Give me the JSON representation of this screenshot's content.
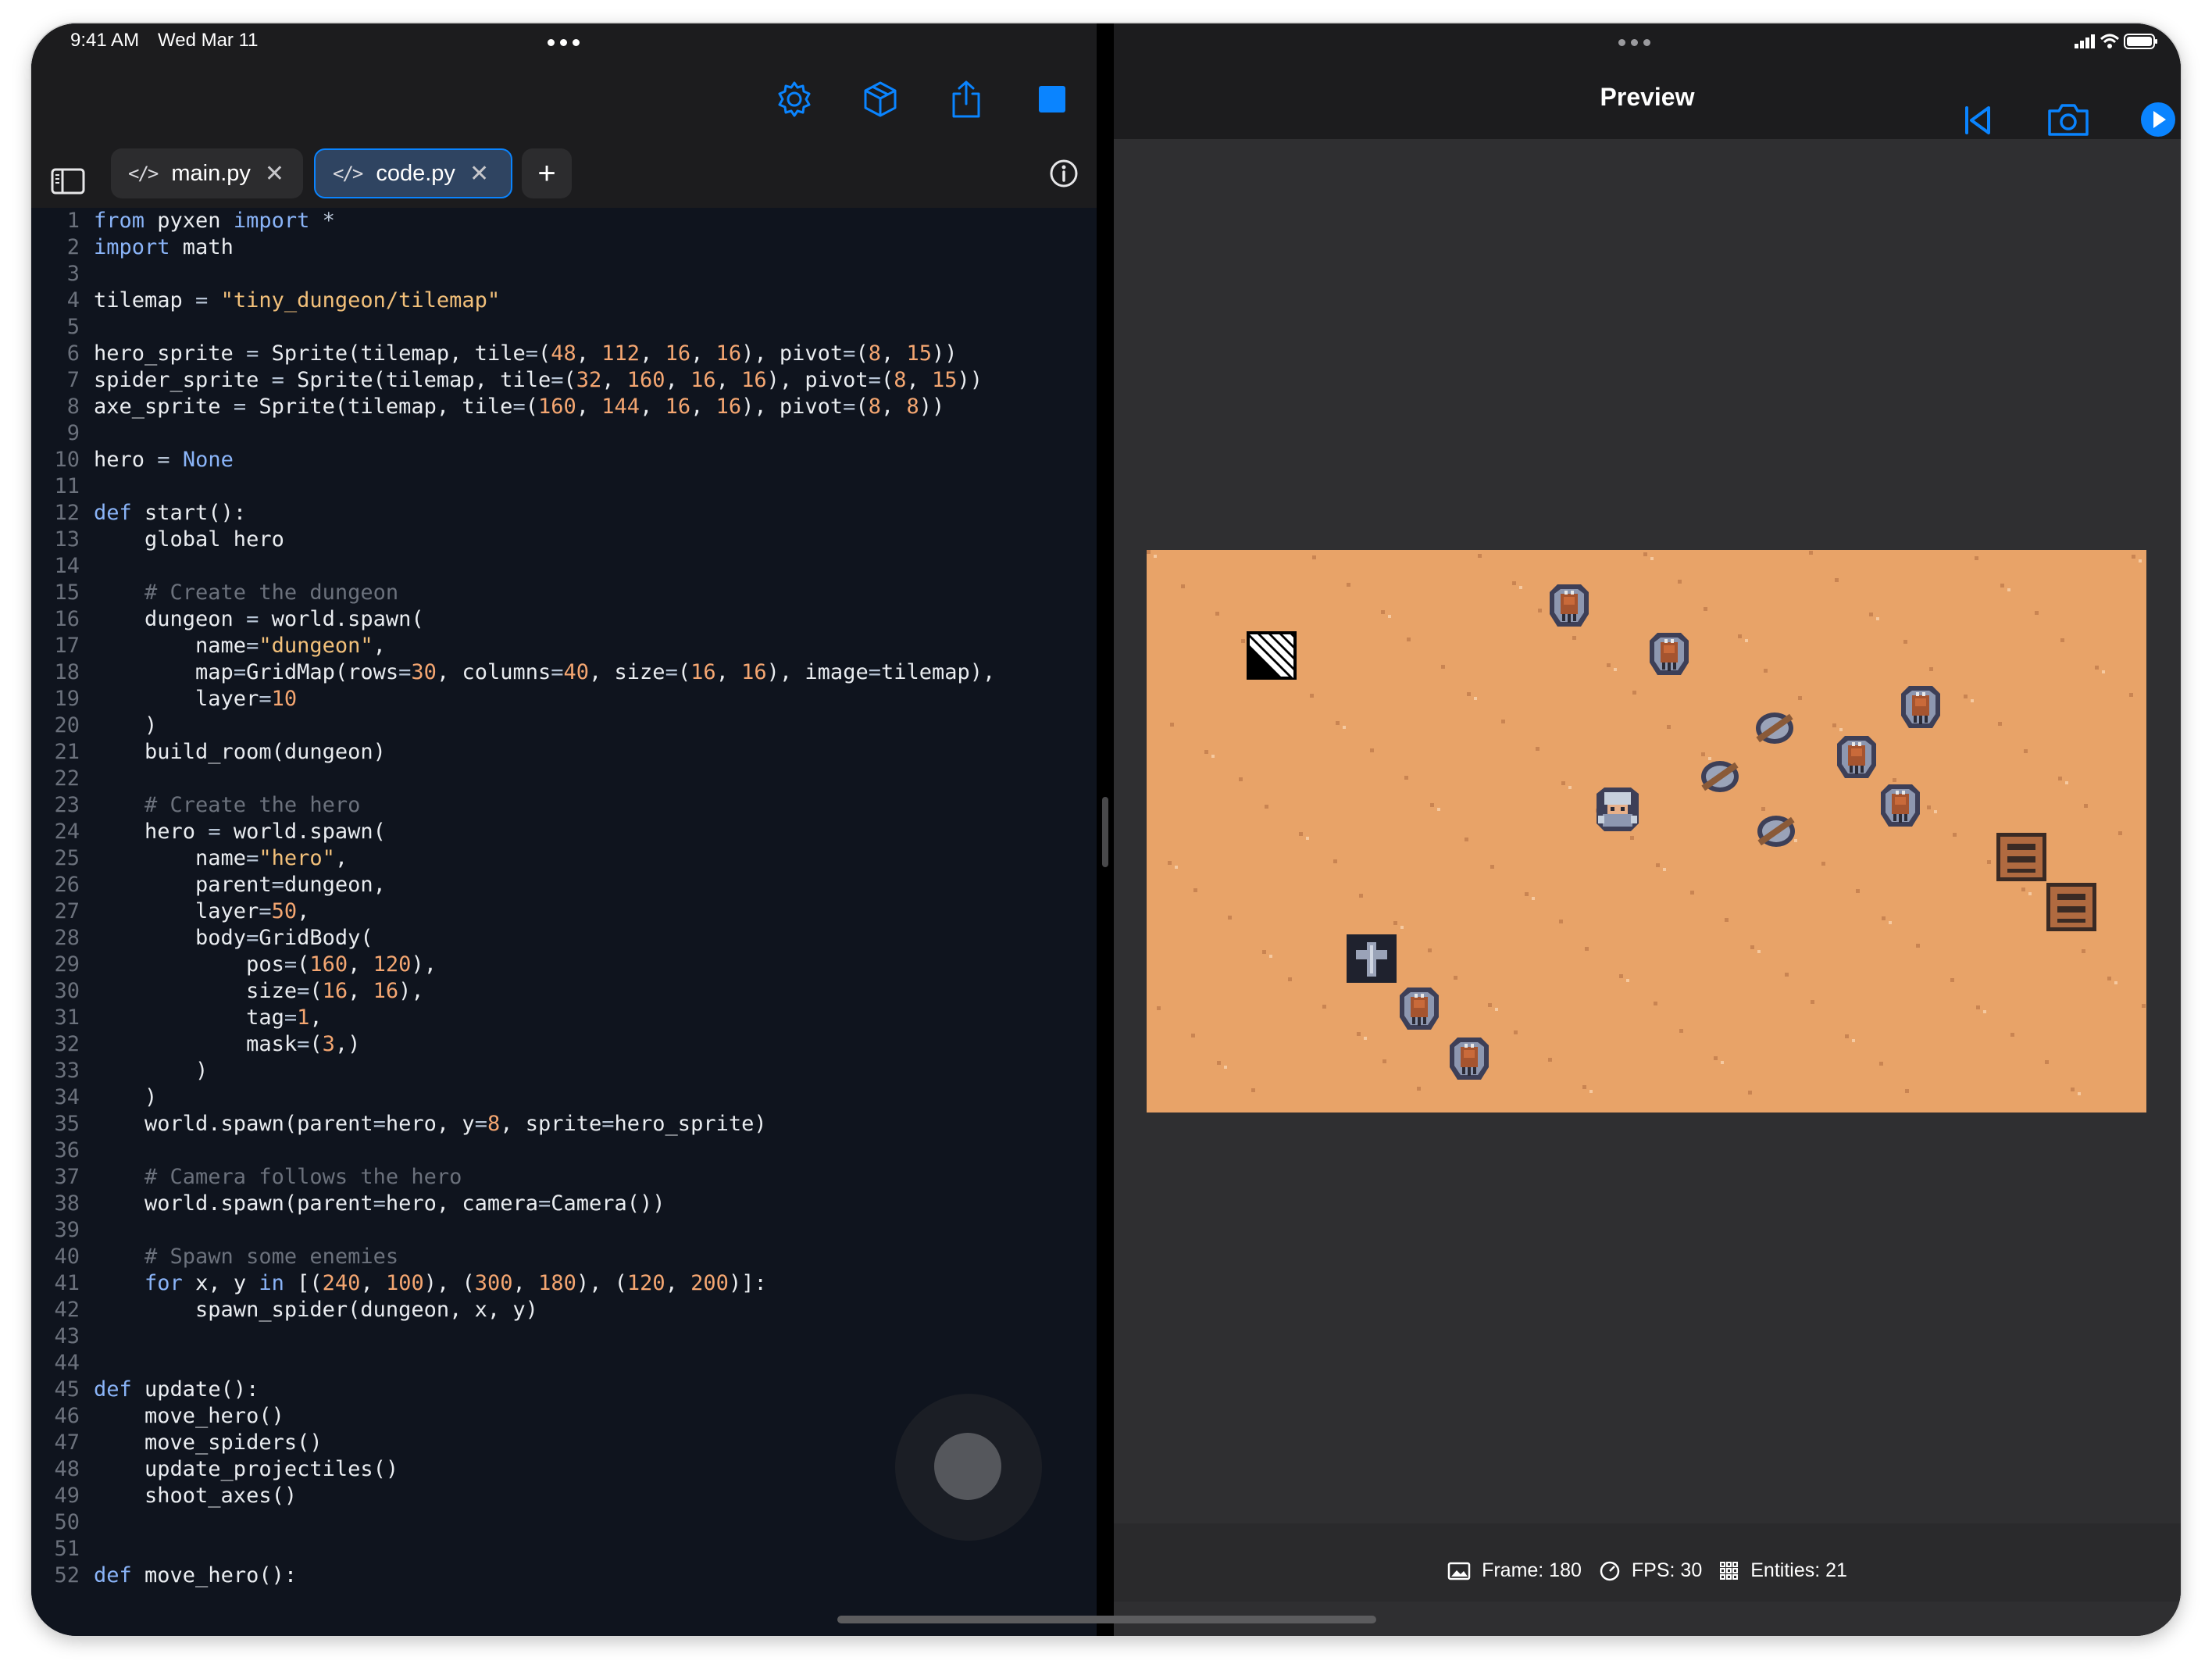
{
  "status_bar": {
    "time": "9:41 AM",
    "date": "Wed Mar 11"
  },
  "colors": {
    "accent": "#0a84ff",
    "editor_bg": "#0f141e",
    "game_floor": "#e8a368"
  },
  "left_toolbar": {
    "icons": [
      "gear-icon",
      "cube-icon",
      "share-icon",
      "stop-icon"
    ]
  },
  "tabs": [
    {
      "label": "main.py",
      "icon": "code-icon",
      "active": false
    },
    {
      "label": "code.py",
      "icon": "code-icon",
      "active": true
    }
  ],
  "tab_bar_icons": [
    "sidebar-icon",
    "plus-icon",
    "info-icon"
  ],
  "code_lines": [
    [
      [
        "kw",
        "from"
      ],
      [
        "t",
        " pyxen "
      ],
      [
        "kw",
        "import"
      ],
      [
        "t",
        " "
      ],
      [
        "op",
        "*"
      ]
    ],
    [
      [
        "kw",
        "import"
      ],
      [
        "t",
        " math"
      ]
    ],
    [],
    [
      [
        "t",
        "tilemap "
      ],
      [
        "op",
        "="
      ],
      [
        "t",
        " "
      ],
      [
        "str",
        "\"tiny_dungeon/tilemap\""
      ]
    ],
    [],
    [
      [
        "t",
        "hero_sprite "
      ],
      [
        "op",
        "="
      ],
      [
        "t",
        " Sprite(tilemap, tile"
      ],
      [
        "op",
        "="
      ],
      [
        "t",
        "("
      ],
      [
        "num",
        "48"
      ],
      [
        "t",
        ", "
      ],
      [
        "num",
        "112"
      ],
      [
        "t",
        ", "
      ],
      [
        "num",
        "16"
      ],
      [
        "t",
        ", "
      ],
      [
        "num",
        "16"
      ],
      [
        "t",
        "), pivot"
      ],
      [
        "op",
        "="
      ],
      [
        "t",
        "("
      ],
      [
        "num",
        "8"
      ],
      [
        "t",
        ", "
      ],
      [
        "num",
        "15"
      ],
      [
        "t",
        "))"
      ]
    ],
    [
      [
        "t",
        "spider_sprite "
      ],
      [
        "op",
        "="
      ],
      [
        "t",
        " Sprite(tilemap, tile"
      ],
      [
        "op",
        "="
      ],
      [
        "t",
        "("
      ],
      [
        "num",
        "32"
      ],
      [
        "t",
        ", "
      ],
      [
        "num",
        "160"
      ],
      [
        "t",
        ", "
      ],
      [
        "num",
        "16"
      ],
      [
        "t",
        ", "
      ],
      [
        "num",
        "16"
      ],
      [
        "t",
        "), pivot"
      ],
      [
        "op",
        "="
      ],
      [
        "t",
        "("
      ],
      [
        "num",
        "8"
      ],
      [
        "t",
        ", "
      ],
      [
        "num",
        "15"
      ],
      [
        "t",
        "))"
      ]
    ],
    [
      [
        "t",
        "axe_sprite "
      ],
      [
        "op",
        "="
      ],
      [
        "t",
        " Sprite(tilemap, tile"
      ],
      [
        "op",
        "="
      ],
      [
        "t",
        "("
      ],
      [
        "num",
        "160"
      ],
      [
        "t",
        ", "
      ],
      [
        "num",
        "144"
      ],
      [
        "t",
        ", "
      ],
      [
        "num",
        "16"
      ],
      [
        "t",
        ", "
      ],
      [
        "num",
        "16"
      ],
      [
        "t",
        "), pivot"
      ],
      [
        "op",
        "="
      ],
      [
        "t",
        "("
      ],
      [
        "num",
        "8"
      ],
      [
        "t",
        ", "
      ],
      [
        "num",
        "8"
      ],
      [
        "t",
        "))"
      ]
    ],
    [],
    [
      [
        "t",
        "hero "
      ],
      [
        "op",
        "="
      ],
      [
        "t",
        " "
      ],
      [
        "kw",
        "None"
      ]
    ],
    [],
    [
      [
        "kw",
        "def"
      ],
      [
        "t",
        " start():"
      ]
    ],
    [
      [
        "t",
        "    global hero"
      ]
    ],
    [],
    [
      [
        "com",
        "    # Create the dungeon"
      ]
    ],
    [
      [
        "t",
        "    dungeon "
      ],
      [
        "op",
        "="
      ],
      [
        "t",
        " world.spawn("
      ]
    ],
    [
      [
        "t",
        "        name"
      ],
      [
        "op",
        "="
      ],
      [
        "str",
        "\"dungeon\""
      ],
      [
        "t",
        ","
      ]
    ],
    [
      [
        "t",
        "        map"
      ],
      [
        "op",
        "="
      ],
      [
        "t",
        "GridMap(rows"
      ],
      [
        "op",
        "="
      ],
      [
        "num",
        "30"
      ],
      [
        "t",
        ", columns"
      ],
      [
        "op",
        "="
      ],
      [
        "num",
        "40"
      ],
      [
        "t",
        ", size"
      ],
      [
        "op",
        "="
      ],
      [
        "t",
        "("
      ],
      [
        "num",
        "16"
      ],
      [
        "t",
        ", "
      ],
      [
        "num",
        "16"
      ],
      [
        "t",
        "), image"
      ],
      [
        "op",
        "="
      ],
      [
        "t",
        "tilemap),"
      ]
    ],
    [
      [
        "t",
        "        layer"
      ],
      [
        "op",
        "="
      ],
      [
        "num",
        "10"
      ]
    ],
    [
      [
        "t",
        "    )"
      ]
    ],
    [
      [
        "t",
        "    build_room(dungeon)"
      ]
    ],
    [],
    [
      [
        "com",
        "    # Create the hero"
      ]
    ],
    [
      [
        "t",
        "    hero "
      ],
      [
        "op",
        "="
      ],
      [
        "t",
        " world.spawn("
      ]
    ],
    [
      [
        "t",
        "        name"
      ],
      [
        "op",
        "="
      ],
      [
        "str",
        "\"hero\""
      ],
      [
        "t",
        ","
      ]
    ],
    [
      [
        "t",
        "        parent"
      ],
      [
        "op",
        "="
      ],
      [
        "t",
        "dungeon,"
      ]
    ],
    [
      [
        "t",
        "        layer"
      ],
      [
        "op",
        "="
      ],
      [
        "num",
        "50"
      ],
      [
        "t",
        ","
      ]
    ],
    [
      [
        "t",
        "        body"
      ],
      [
        "op",
        "="
      ],
      [
        "t",
        "GridBody("
      ]
    ],
    [
      [
        "t",
        "            pos"
      ],
      [
        "op",
        "="
      ],
      [
        "t",
        "("
      ],
      [
        "num",
        "160"
      ],
      [
        "t",
        ", "
      ],
      [
        "num",
        "120"
      ],
      [
        "t",
        "),"
      ]
    ],
    [
      [
        "t",
        "            size"
      ],
      [
        "op",
        "="
      ],
      [
        "t",
        "("
      ],
      [
        "num",
        "16"
      ],
      [
        "t",
        ", "
      ],
      [
        "num",
        "16"
      ],
      [
        "t",
        "),"
      ]
    ],
    [
      [
        "t",
        "            tag"
      ],
      [
        "op",
        "="
      ],
      [
        "num",
        "1"
      ],
      [
        "t",
        ","
      ]
    ],
    [
      [
        "t",
        "            mask"
      ],
      [
        "op",
        "="
      ],
      [
        "t",
        "("
      ],
      [
        "num",
        "3"
      ],
      [
        "t",
        ",)"
      ]
    ],
    [
      [
        "t",
        "        )"
      ]
    ],
    [
      [
        "t",
        "    )"
      ]
    ],
    [
      [
        "t",
        "    world.spawn(parent"
      ],
      [
        "op",
        "="
      ],
      [
        "t",
        "hero, y"
      ],
      [
        "op",
        "="
      ],
      [
        "num",
        "8"
      ],
      [
        "t",
        ", sprite"
      ],
      [
        "op",
        "="
      ],
      [
        "t",
        "hero_sprite)"
      ]
    ],
    [],
    [
      [
        "com",
        "    # Camera follows the hero"
      ]
    ],
    [
      [
        "t",
        "    world.spawn(parent"
      ],
      [
        "op",
        "="
      ],
      [
        "t",
        "hero, camera"
      ],
      [
        "op",
        "="
      ],
      [
        "t",
        "Camera())"
      ]
    ],
    [],
    [
      [
        "com",
        "    # Spawn some enemies"
      ]
    ],
    [
      [
        "t",
        "    "
      ],
      [
        "kw",
        "for"
      ],
      [
        "t",
        " x, y "
      ],
      [
        "kw",
        "in"
      ],
      [
        "t",
        " [("
      ],
      [
        "num",
        "240"
      ],
      [
        "t",
        ", "
      ],
      [
        "num",
        "100"
      ],
      [
        "t",
        "), ("
      ],
      [
        "num",
        "300"
      ],
      [
        "t",
        ", "
      ],
      [
        "num",
        "180"
      ],
      [
        "t",
        "), ("
      ],
      [
        "num",
        "120"
      ],
      [
        "t",
        ", "
      ],
      [
        "num",
        "200"
      ],
      [
        "t",
        ")]:"
      ]
    ],
    [
      [
        "t",
        "        spawn_spider(dungeon, x, y)"
      ]
    ],
    [],
    [],
    [
      [
        "kw",
        "def"
      ],
      [
        "t",
        " update():"
      ]
    ],
    [
      [
        "t",
        "    move_hero()"
      ]
    ],
    [
      [
        "t",
        "    move_spiders()"
      ]
    ],
    [
      [
        "t",
        "    update_projectiles()"
      ]
    ],
    [
      [
        "t",
        "    shoot_axes()"
      ]
    ],
    [],
    [],
    [
      [
        "kw",
        "def"
      ],
      [
        "t",
        " move_hero():"
      ]
    ]
  ],
  "preview": {
    "title": "Preview",
    "toolbar_icons": [
      "rewind-icon",
      "camera-icon",
      "play-icon"
    ],
    "stats": {
      "frame": "Frame: 180",
      "fps": "FPS: 30",
      "entities": "Entities: 21"
    }
  }
}
